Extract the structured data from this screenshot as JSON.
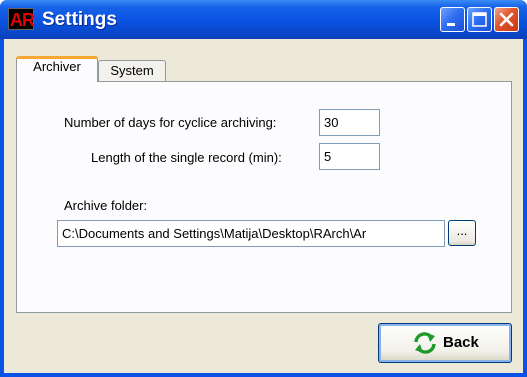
{
  "window": {
    "title": "Settings",
    "app_icon_text": "AR",
    "controls": [
      "minimize",
      "maximize",
      "close"
    ]
  },
  "tabs": [
    {
      "label": "Archiver",
      "active": true
    },
    {
      "label": "System",
      "active": false
    }
  ],
  "archiver": {
    "days_label": "Number of days for cyclice archiving:",
    "days_value": "30",
    "length_label": "Length of the single record (min):",
    "length_value": "5",
    "folder_label": "Archive folder:",
    "folder_value": "C:\\Documents and Settings\\Matija\\Desktop\\RArch\\Ar",
    "browse_label": "..."
  },
  "footer": {
    "back_label": "Back"
  },
  "icons": {
    "back": "refresh-arrows-icon"
  },
  "colors": {
    "titlebar": "#0a52e2",
    "tab_highlight": "#f6a830",
    "close_button": "#e0542c",
    "refresh_icon": "#1e9a2a"
  }
}
